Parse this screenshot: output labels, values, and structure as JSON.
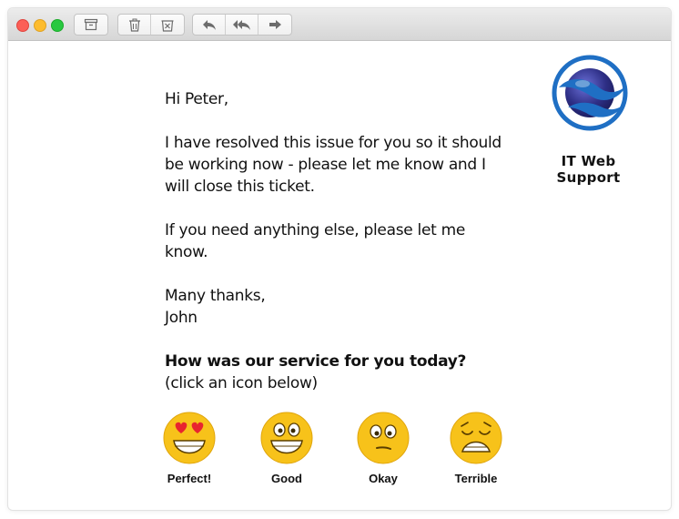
{
  "toolbar": {
    "window_controls": [
      "close",
      "minimize",
      "zoom"
    ],
    "buttons": [
      "archive-icon",
      "trash-icon",
      "junk-icon",
      "reply-icon",
      "reply-all-icon",
      "forward-icon"
    ]
  },
  "email": {
    "greeting": "Hi Peter,",
    "paragraph_1": "I have resolved this issue for you so it should be working now - please let me know and I will close this ticket.",
    "paragraph_2": "If you need anything else, please let me know.",
    "closing": "Many thanks,",
    "signature": "John",
    "survey_question": "How was our service for you today?",
    "survey_instruction": "(click an icon below)"
  },
  "logo": {
    "text": "IT Web Support",
    "colors": {
      "blue": "#1f6fc4",
      "navy": "#2e2f86"
    }
  },
  "ratings": [
    {
      "label": "Perfect!",
      "icon": "heart-eyes-emoji-icon"
    },
    {
      "label": "Good",
      "icon": "grinning-emoji-icon"
    },
    {
      "label": "Okay",
      "icon": "neutral-emoji-icon"
    },
    {
      "label": "Terrible",
      "icon": "weary-emoji-icon"
    }
  ],
  "colors": {
    "emoji_yellow": "#f7c21a",
    "heart_red": "#e8242f"
  }
}
